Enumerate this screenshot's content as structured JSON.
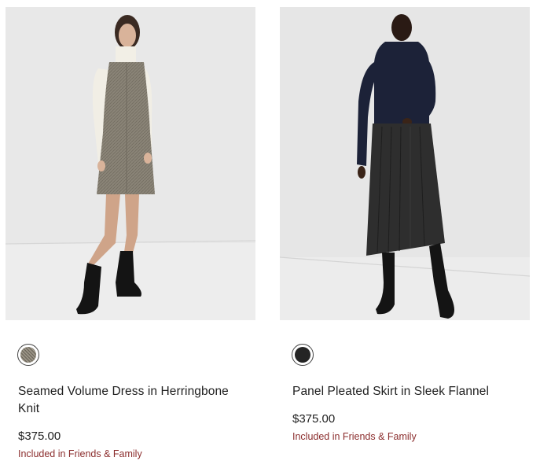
{
  "products": [
    {
      "name": "Seamed Volume Dress in Herringbone Knit",
      "price": "$375.00",
      "promo": "Included in Friends & Family",
      "swatch": {
        "icon": "herringbone-swatch-icon",
        "color": "#8a8477"
      },
      "image": "model in herringbone sleeveless dress over white turtleneck with black combat boots"
    },
    {
      "name": "Panel Pleated Skirt in Sleek Flannel",
      "price": "$375.00",
      "promo": "Included in Friends & Family",
      "swatch": {
        "icon": "flannel-swatch-icon",
        "color": "#242424"
      },
      "image": "model in navy turtleneck and dark grey pleated skirt with black lace-up boots"
    }
  ],
  "colors": {
    "text": "#1f1f1f",
    "promo": "#8b2d2d",
    "photo_background": "#e9e9e9"
  }
}
